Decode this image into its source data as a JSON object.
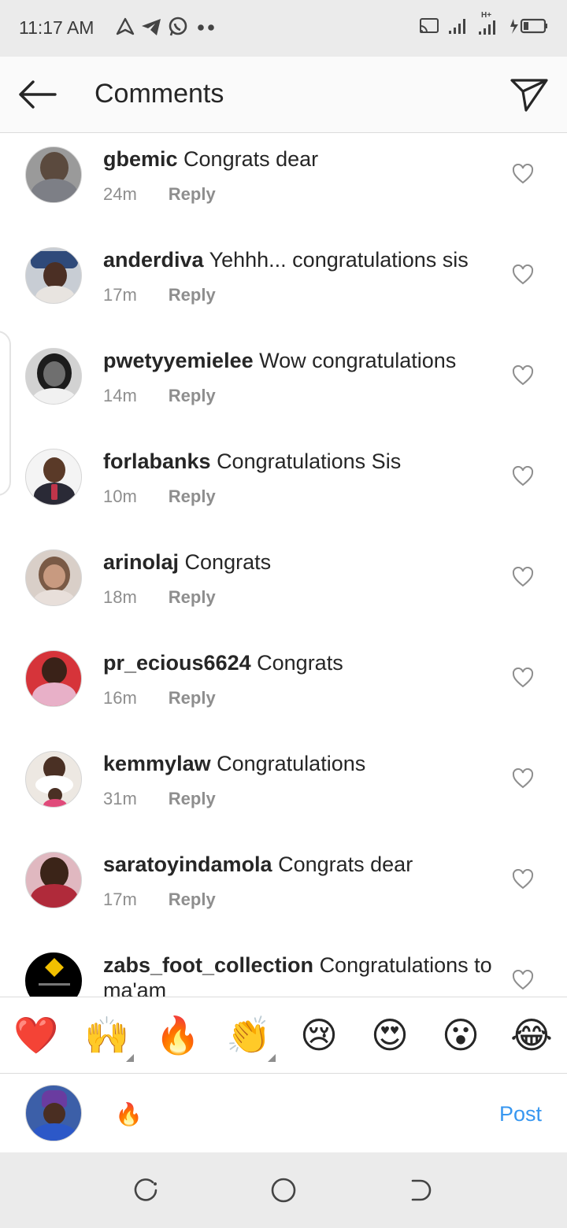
{
  "status_bar": {
    "time": "11:17 AM",
    "left_icons": [
      "nav-arrow-icon",
      "telegram-icon",
      "whatsapp-icon",
      "more-dots-icon"
    ],
    "right_icons": [
      "cast-icon",
      "signal-icon",
      "signal-hplus-icon",
      "battery-charging-icon"
    ],
    "network_label": "H+"
  },
  "header": {
    "title": "Comments"
  },
  "colors": {
    "accent": "#3897f0",
    "text_primary": "#262626",
    "text_secondary": "#8e8e8e",
    "status_bar_bg": "#ebebeb",
    "header_bg": "#fafafa"
  },
  "comments": [
    {
      "username": "gbemic",
      "text": "Congrats dear",
      "time": "24m",
      "reply": "Reply"
    },
    {
      "username": "anderdiva",
      "text": "Yehhh... congratulations sis",
      "time": "17m",
      "reply": "Reply"
    },
    {
      "username": "pwetyyemielee",
      "text": "Wow congratulations",
      "time": "14m",
      "reply": "Reply"
    },
    {
      "username": "forlabanks",
      "text": "Congratulations Sis",
      "time": "10m",
      "reply": "Reply"
    },
    {
      "username": "arinolaj",
      "text": "Congrats",
      "time": "18m",
      "reply": "Reply"
    },
    {
      "username": "pr_ecious6624",
      "text": "Congrats",
      "time": "16m",
      "reply": "Reply"
    },
    {
      "username": "kemmylaw",
      "text": "Congratulations",
      "time": "31m",
      "reply": "Reply"
    },
    {
      "username": "saratoyindamola",
      "text": "Congrats dear",
      "time": "17m",
      "reply": "Reply"
    },
    {
      "username": "zabs_foot_collection",
      "text": "Congratulations to ma'am",
      "time": "",
      "reply": ""
    }
  ],
  "emoji_bar": [
    {
      "name": "red-heart",
      "char": "❤️"
    },
    {
      "name": "raising-hands",
      "char": "🙌"
    },
    {
      "name": "fire",
      "char": "🔥"
    },
    {
      "name": "clapping-hands",
      "char": "👏"
    },
    {
      "name": "crying-face",
      "char": "😢"
    },
    {
      "name": "heart-eyes",
      "char": "😍"
    },
    {
      "name": "astonished-face",
      "char": "😮"
    },
    {
      "name": "tears-of-joy",
      "char": "😂"
    }
  ],
  "composer": {
    "input_value": "🔥",
    "post_label": "Post"
  },
  "nav_bar": {
    "buttons": [
      "recent-apps-icon",
      "home-icon",
      "back-icon"
    ]
  }
}
